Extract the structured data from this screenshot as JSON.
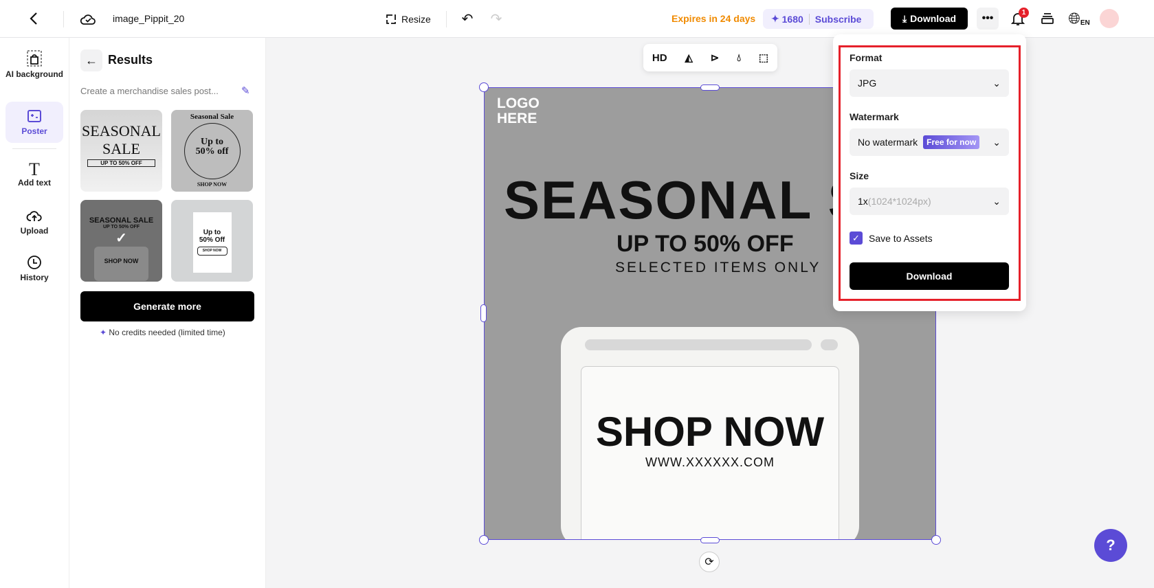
{
  "header": {
    "title": "image_Pippit_20",
    "resize": "Resize",
    "expires": "Expires in 24 days",
    "credits": "1680",
    "subscribe": "Subscribe",
    "download": "Download",
    "notifications": "1",
    "lang": "EN"
  },
  "rail": [
    {
      "label": "AI background"
    },
    {
      "label": "Poster"
    },
    {
      "label": "Add text"
    },
    {
      "label": "Upload"
    },
    {
      "label": "History"
    }
  ],
  "panel": {
    "title": "Results",
    "prompt": "Create a merchandise sales post...",
    "generate": "Generate more",
    "note": "No credits needed (limited time)",
    "thumbs": [
      {
        "l1": "SEASONAL",
        "l2": "SALE",
        "l3": "UP TO 50% OFF"
      },
      {
        "l1": "Seasonal Sale",
        "l2": "Up to",
        "l3": "50% off",
        "l4": "SHOP NOW"
      },
      {
        "l1": "SEASONAL SALE",
        "l2": "UP TO 50% OFF",
        "l3": "SHOP NOW"
      },
      {
        "l1": "Up to",
        "l2": "50% Off",
        "l3": "SHOP NOW"
      }
    ]
  },
  "toolbar": {
    "hd": "HD"
  },
  "poster": {
    "logo1": "LOGO",
    "logo2": "HERE",
    "headline": "SEASONAL SALE",
    "offer": "UP TO 50% OFF",
    "sub": "SELECTED ITEMS ONLY",
    "cta": "SHOP NOW",
    "url": "WWW.XXXXXX.COM"
  },
  "dropdown": {
    "format_label": "Format",
    "format": "JPG",
    "watermark_label": "Watermark",
    "watermark": "No watermark",
    "badge": "Free for now",
    "size_label": "Size",
    "size": "1x",
    "size_px": "(1024*1024px)",
    "save_assets": "Save to Assets",
    "download": "Download"
  },
  "colors": {
    "accent": "#5b4bd6",
    "orange": "#f08a00",
    "highlight": "#e5202a"
  }
}
